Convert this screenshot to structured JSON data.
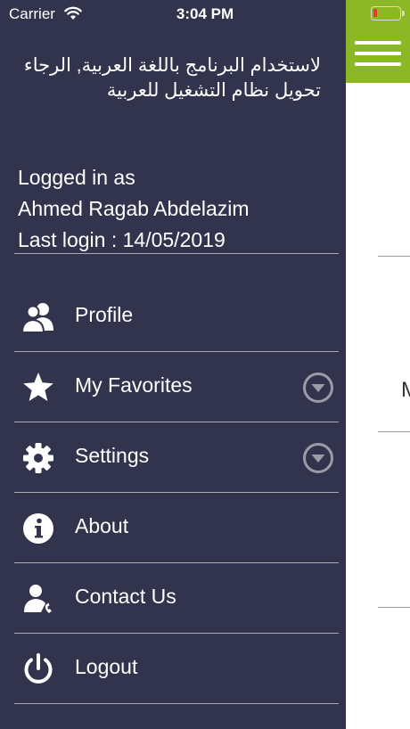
{
  "status_bar": {
    "carrier": "Carrier",
    "time": "3:04 PM"
  },
  "drawer": {
    "arabic_notice": "لاستخدام البرنامج باللغة العربية, الرجاء تحويل نظام التشغيل للعربية",
    "logged_in_label": "Logged in as",
    "user_name": "Ahmed Ragab Abdelazim",
    "last_login": "Last login : 14/05/2019",
    "menu": [
      {
        "label": "Profile",
        "icon": "profile-icon",
        "expandable": false
      },
      {
        "label": "My Favorites",
        "icon": "star-icon",
        "expandable": true
      },
      {
        "label": "Settings",
        "icon": "gear-icon",
        "expandable": true
      },
      {
        "label": "About",
        "icon": "info-icon",
        "expandable": false
      },
      {
        "label": "Contact Us",
        "icon": "contact-icon",
        "expandable": false
      },
      {
        "label": "Logout",
        "icon": "power-icon",
        "expandable": false
      }
    ]
  },
  "main": {
    "peek_text": "M"
  },
  "colors": {
    "drawer_bg": "#31344c",
    "header_green": "#8db826",
    "divider": "#a9aab6",
    "battery_low": "#e53b2b"
  }
}
